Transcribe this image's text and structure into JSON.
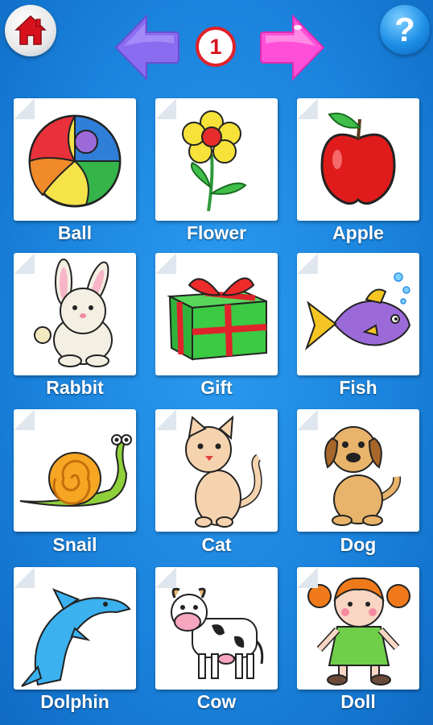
{
  "header": {
    "page_number": "1",
    "help_symbol": "?"
  },
  "colors": {
    "background": "#1a82dc",
    "prev_arrow": "#8a6cf0",
    "next_arrow": "#ff4fd8",
    "badge_border": "#e0222b",
    "home_icon": "#d8121d"
  },
  "icons": {
    "home": "house-icon",
    "prev": "arrow-left-icon",
    "next": "arrow-right-icon",
    "help": "question-mark-icon"
  },
  "items": [
    {
      "label": "Ball"
    },
    {
      "label": "Flower"
    },
    {
      "label": "Apple"
    },
    {
      "label": "Rabbit"
    },
    {
      "label": "Gift"
    },
    {
      "label": "Fish"
    },
    {
      "label": "Snail"
    },
    {
      "label": "Cat"
    },
    {
      "label": "Dog"
    },
    {
      "label": "Dolphin"
    },
    {
      "label": "Cow"
    },
    {
      "label": "Doll"
    }
  ]
}
